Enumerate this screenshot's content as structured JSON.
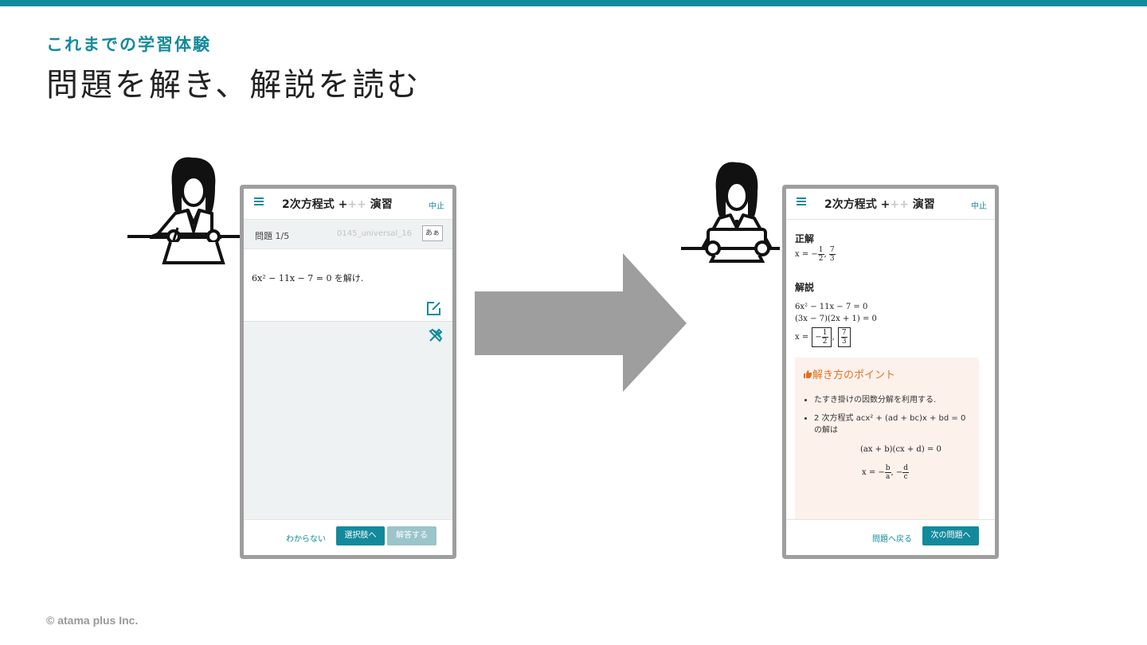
{
  "slide": {
    "subtitle": "これまでの学習体験",
    "title": "問題を解き、解説を読む",
    "copyright": "© atama plus Inc."
  },
  "left_phone": {
    "header": {
      "title_main": "2次方程式 ",
      "plus_on": "+",
      "plus_off": "++",
      "title_suffix": " 演習",
      "stop": "中止"
    },
    "question_bar": {
      "number": "問題 1/5",
      "id": "0145_universal_16",
      "font_toggle": "あぁ"
    },
    "question_text": "6x² − 11x − 7 = 0 を解け.",
    "footer": {
      "dont_know": "わからない",
      "to_choices": "選択肢へ",
      "answer": "解答する"
    }
  },
  "right_phone": {
    "header": {
      "title_main": "2次方程式 ",
      "plus_on": "+",
      "plus_off": "++",
      "title_suffix": " 演習",
      "stop": "中止"
    },
    "answer_heading": "正解",
    "answer_lhs": "x = −",
    "answer_f1_num": "1",
    "answer_f1_den": "2",
    "answer_sep": ", ",
    "answer_f2_num": "7",
    "answer_f2_den": "3",
    "explanation_heading": "解説",
    "explanation_line1": "6x² − 11x − 7 = 0",
    "explanation_line2": "(3x − 7)(2x + 1) = 0",
    "explanation_line3_lhs": "x =",
    "explanation_box1": "−",
    "point": {
      "heading": "解き方のポイント",
      "bullet1": "たすき掛けの因数分解を利用する.",
      "bullet2": "2 次方程式 acx² + (ad + bc)x + bd = 0",
      "bullet2_cont": "の解は",
      "formula1": "(ax + b)(cx + d) = 0",
      "formula2_lhs": "x = −",
      "formula2_f1_num": "b",
      "formula2_f1_den": "a",
      "formula2_sep": ", −",
      "formula2_f2_num": "d",
      "formula2_f2_den": "c"
    },
    "footer": {
      "back": "問題へ戻る",
      "next": "次の問題へ"
    }
  },
  "colors": {
    "accent": "#138a9c",
    "frame": "#9e9e9e",
    "arrow": "#9e9e9e",
    "point_bg": "#fdf1ec",
    "point_heading": "#e2711d"
  },
  "icons": [
    "menu-icon",
    "edit-icon",
    "tools-icon",
    "thumbs-up-icon",
    "student-writing-icon",
    "student-reading-icon",
    "right-arrow-icon"
  ]
}
